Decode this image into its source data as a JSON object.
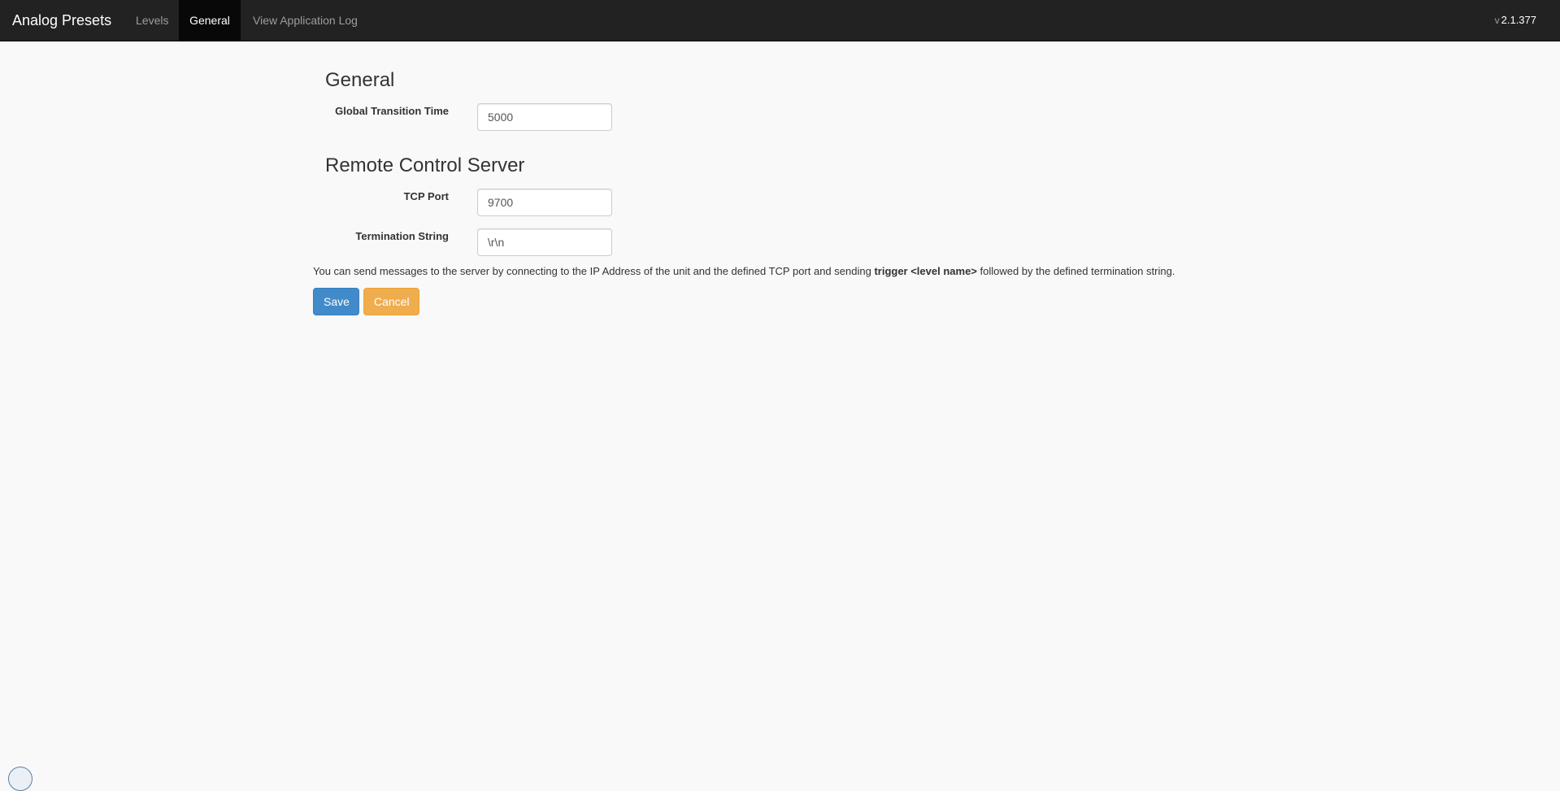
{
  "navbar": {
    "brand": "Analog Presets",
    "items": [
      {
        "label": "Levels",
        "active": false
      },
      {
        "label": "General",
        "active": true
      },
      {
        "label": "View Application Log",
        "active": false
      }
    ],
    "version_prefix": "v",
    "version": "2.1.377"
  },
  "general": {
    "title": "General",
    "global_transition_time": {
      "label": "Global Transition Time",
      "value": "5000"
    }
  },
  "remote_control": {
    "title": "Remote Control Server",
    "tcp_port": {
      "label": "TCP Port",
      "value": "9700"
    },
    "termination_string": {
      "label": "Termination String",
      "value": "\\r\\n"
    },
    "help": {
      "before": "You can send messages to the server by connecting to the IP Address of the unit and the defined TCP port and sending ",
      "command": "trigger <level name>",
      "after": " followed by the defined termination string."
    }
  },
  "buttons": {
    "save_label": "Save",
    "cancel_label": "Cancel"
  },
  "colors": {
    "navbar_bg": "#222222",
    "save_button": "#428bca",
    "cancel_button": "#f0ad4e",
    "page_bg": "#f9f9f9"
  }
}
